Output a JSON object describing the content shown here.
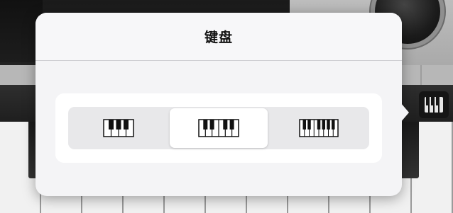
{
  "popover": {
    "title": "键盘"
  },
  "key_size_options": [
    {
      "icon": "keyboard-large-keys-icon",
      "white_keys": 4,
      "selected": false
    },
    {
      "icon": "keyboard-medium-keys-icon",
      "white_keys": 6,
      "selected": true
    },
    {
      "icon": "keyboard-small-keys-icon",
      "white_keys": 7,
      "selected": false
    }
  ],
  "toolbar": {
    "keyboard_button_icon": "piano-keys-icon"
  },
  "colors": {
    "popover_bg": "#f4f4f6",
    "segment_bg": "#e8e8ea",
    "selected_segment": "#ffffff"
  }
}
